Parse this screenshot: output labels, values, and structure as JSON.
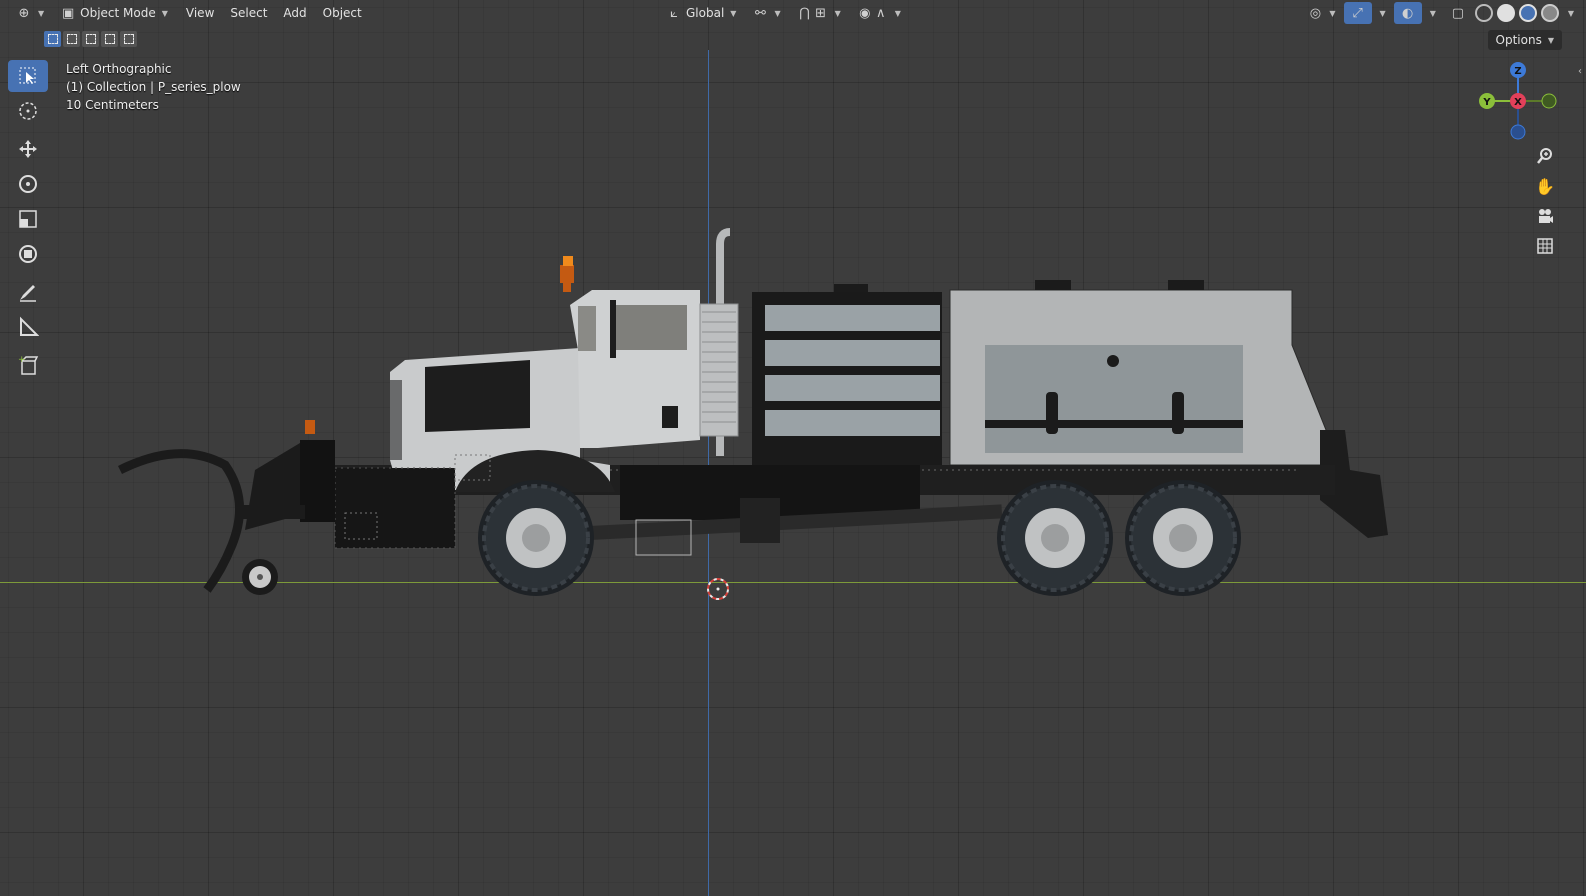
{
  "header": {
    "mode": "Object Mode",
    "menus": [
      "View",
      "Select",
      "Add",
      "Object"
    ],
    "orientation": "Global",
    "options": "Options"
  },
  "overlay": {
    "view_name": "Left Orthographic",
    "collection": "(1) Collection | P_series_plow",
    "grid_scale": "10 Centimeters"
  },
  "gizmo": {
    "z": "Z",
    "y": "Y",
    "x": "X"
  },
  "toolbar": {
    "tools": [
      "select-box-tool",
      "cursor-tool",
      "move-tool",
      "rotate-tool",
      "scale-tool",
      "transform-tool",
      "annotate-tool",
      "measure-tool",
      "add-cube-tool"
    ],
    "active": "select-box-tool"
  },
  "colors": {
    "viewport_bg": "#3d3d3d",
    "accent": "#4772b3",
    "x_axis": "#e2405a",
    "y_axis": "#8bbf3a",
    "z_axis": "#3d7ad8"
  }
}
